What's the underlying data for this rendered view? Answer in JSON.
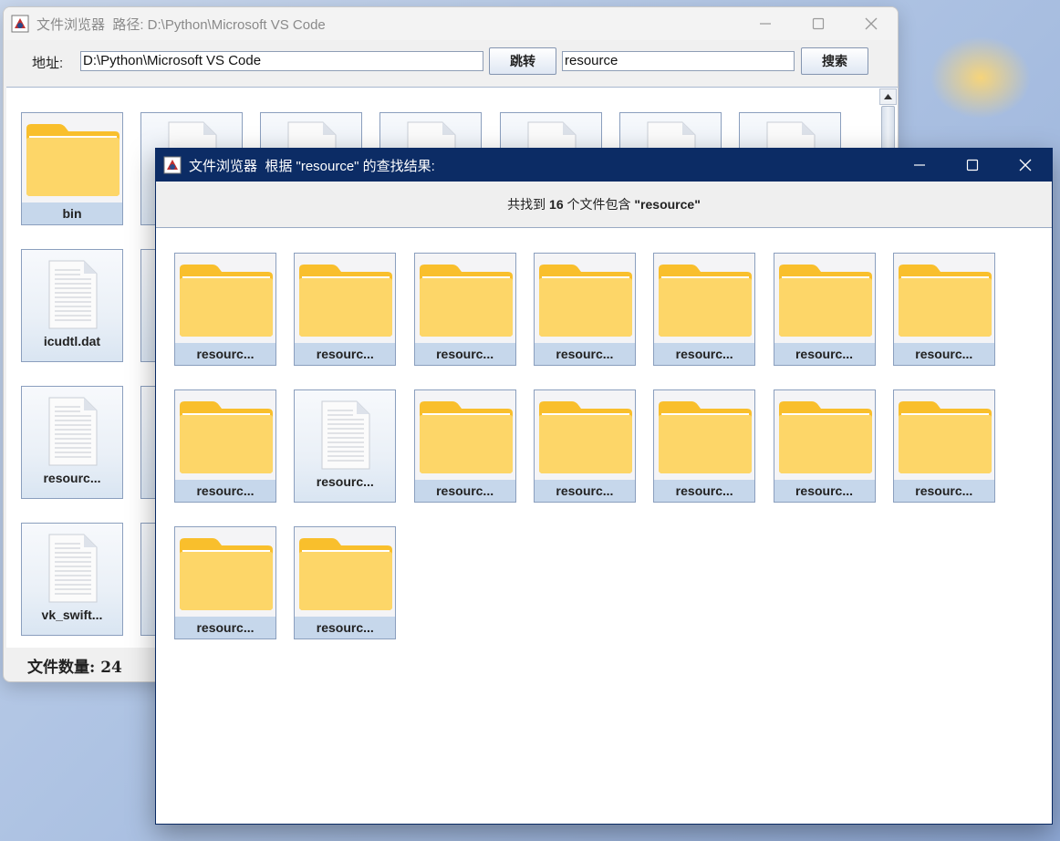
{
  "back_window": {
    "title": "文件浏览器  路径: D:\\Python\\Microsoft VS Code",
    "address_label": "地址:",
    "address_value": "D:\\Python\\Microsoft VS Code",
    "go_button": "跳转",
    "search_value": "resource",
    "search_button": "搜索",
    "items": [
      {
        "name": "bin",
        "type": "folder"
      },
      {
        "name": "icudtl.dat",
        "type": "file"
      },
      {
        "name": "resourc...",
        "type": "file"
      },
      {
        "name": "vk_swift...",
        "type": "file"
      }
    ],
    "file_count": "文件数量: 24"
  },
  "front_window": {
    "title": "文件浏览器  根据 \"resource\" 的查找结果:",
    "result_prefix": "共找到",
    "result_count": "16",
    "result_middle": "个文件包含",
    "result_query": "\"resource\"",
    "results": [
      {
        "name": "resourc...",
        "type": "folder"
      },
      {
        "name": "resourc...",
        "type": "folder"
      },
      {
        "name": "resourc...",
        "type": "folder"
      },
      {
        "name": "resourc...",
        "type": "folder"
      },
      {
        "name": "resourc...",
        "type": "folder"
      },
      {
        "name": "resourc...",
        "type": "folder"
      },
      {
        "name": "resourc...",
        "type": "folder"
      },
      {
        "name": "resourc...",
        "type": "folder"
      },
      {
        "name": "resourc...",
        "type": "file"
      },
      {
        "name": "resourc...",
        "type": "folder"
      },
      {
        "name": "resourc...",
        "type": "folder"
      },
      {
        "name": "resourc...",
        "type": "folder"
      },
      {
        "name": "resourc...",
        "type": "folder"
      },
      {
        "name": "resourc...",
        "type": "folder"
      },
      {
        "name": "resourc...",
        "type": "folder"
      },
      {
        "name": "resourc...",
        "type": "folder"
      }
    ]
  },
  "icons": {
    "folder": "folder-icon",
    "file": "document-icon",
    "app": "java-app-icon"
  },
  "colors": {
    "front_titlebar": "#0c2c65",
    "folder_yellow": "#fdd668",
    "tile_caption": "#c6d7eb"
  }
}
